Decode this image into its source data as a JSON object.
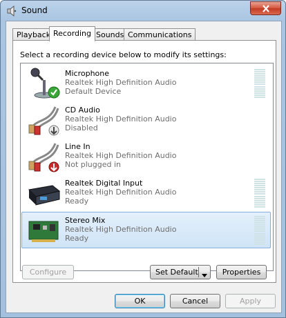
{
  "window": {
    "title": "Sound"
  },
  "tabs": [
    {
      "label": "Playback"
    },
    {
      "label": "Recording"
    },
    {
      "label": "Sounds"
    },
    {
      "label": "Communications"
    }
  ],
  "instruction": "Select a recording device below to modify its settings:",
  "devices": [
    {
      "name": "Microphone",
      "driver": "Realtek High Definition Audio",
      "status": "Default Device",
      "icon": "microphone-icon",
      "badge": "check"
    },
    {
      "name": "CD Audio",
      "driver": "Realtek High Definition Audio",
      "status": "Disabled",
      "icon": "cable-icon",
      "badge": "down-arrow-gray"
    },
    {
      "name": "Line In",
      "driver": "Realtek High Definition Audio",
      "status": "Not plugged in",
      "icon": "cable-icon",
      "badge": "down-arrow-red"
    },
    {
      "name": "Realtek Digital Input",
      "driver": "Realtek High Definition Audio",
      "status": "Ready",
      "icon": "digital-device-icon",
      "badge": ""
    },
    {
      "name": "Stereo Mix",
      "driver": "Realtek High Definition Audio",
      "status": "Ready",
      "icon": "sound-card-icon",
      "badge": ""
    }
  ],
  "buttons": {
    "configure": "Configure",
    "set_default": "Set Default",
    "properties": "Properties",
    "ok": "OK",
    "cancel": "Cancel",
    "apply": "Apply"
  },
  "colors": {
    "selection": "#cfe4f7",
    "close": "#c23a22"
  }
}
